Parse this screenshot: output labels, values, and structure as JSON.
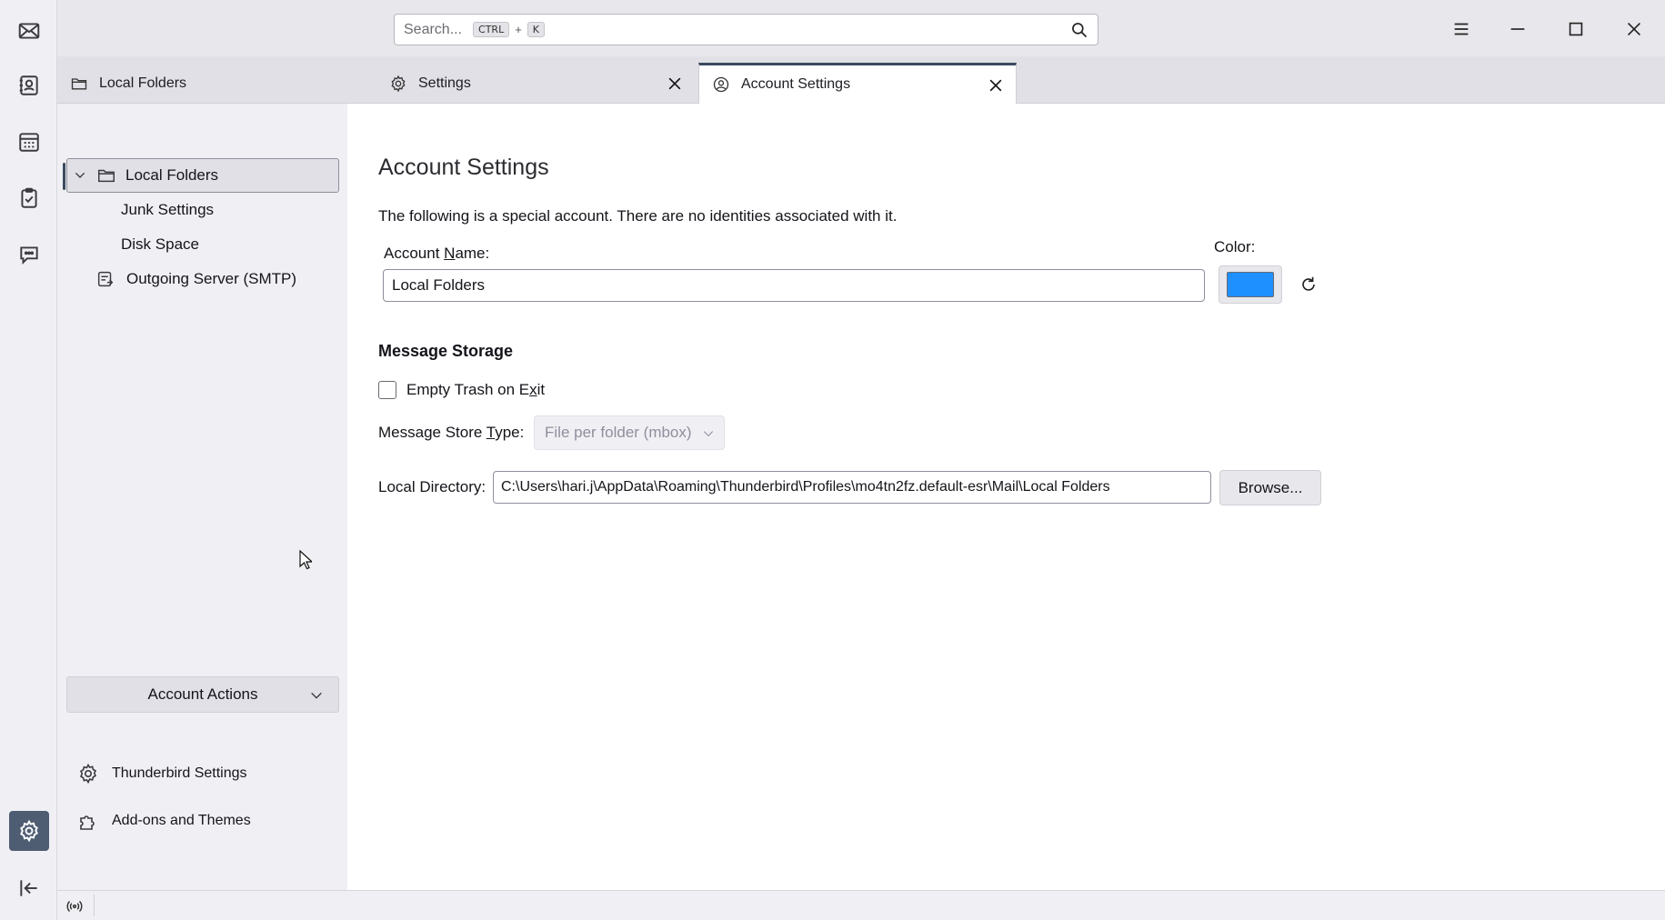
{
  "spaces": [
    {
      "name": "mail-space-icon"
    },
    {
      "name": "address-book-space-icon"
    },
    {
      "name": "calendar-space-icon"
    },
    {
      "name": "tasks-space-icon"
    },
    {
      "name": "chat-space-icon"
    }
  ],
  "search": {
    "placeholder": "Search...",
    "key1": "CTRL",
    "plus": "+",
    "key2": "K"
  },
  "tabs": [
    {
      "label": "Local Folders",
      "icon": "folder-icon",
      "closable": false
    },
    {
      "label": "Settings",
      "icon": "gear-icon",
      "closable": true
    },
    {
      "label": "Account Settings",
      "icon": "account-icon",
      "closable": true,
      "selected": true
    }
  ],
  "tree": {
    "account": "Local Folders",
    "children": [
      "Junk Settings",
      "Disk Space"
    ],
    "smtp": "Outgoing Server (SMTP)"
  },
  "account_actions": "Account Actions",
  "bottom_links": {
    "thunderbird_settings": "Thunderbird Settings",
    "addons": "Add-ons and Themes"
  },
  "main": {
    "title": "Account Settings",
    "description": "The following is a special account. There are no identities associated with it.",
    "account_name_label_pre": "Account ",
    "account_name_label_key": "N",
    "account_name_label_post": "ame:",
    "account_name_value": "Local Folders",
    "color_label": "Color:",
    "color_value": "#1e90ff",
    "storage_heading": "Message Storage",
    "empty_trash_pre": "Empty Trash on E",
    "empty_trash_key": "x",
    "empty_trash_post": "it",
    "store_type_label_pre": "Message Store ",
    "store_type_label_key": "T",
    "store_type_label_post": "ype:",
    "store_type_value": "File per folder (mbox)",
    "local_dir_label": "Local Directory:",
    "local_dir_value": "C:\\Users\\hari.j\\AppData\\Roaming\\Thunderbird\\Profiles\\mo4tn2fz.default-esr\\Mail\\Local Folders",
    "browse_label": "Browse..."
  }
}
